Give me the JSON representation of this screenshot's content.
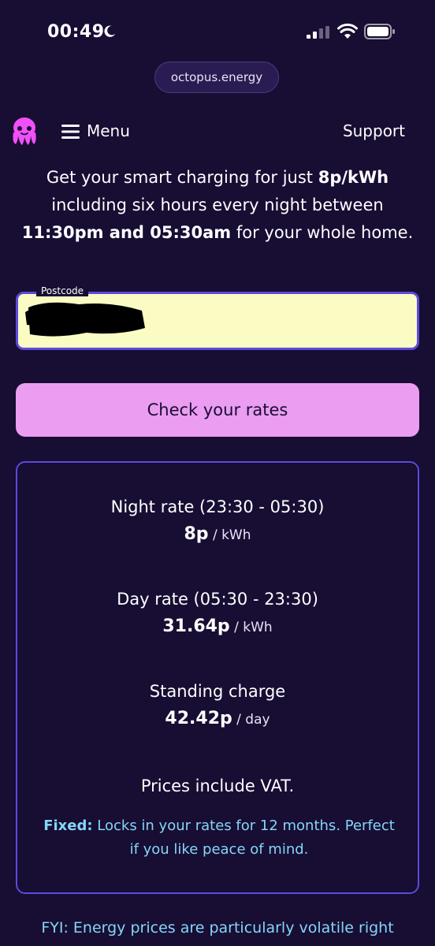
{
  "status_bar": {
    "time": "00:49",
    "icons": [
      "moon-icon",
      "signal-icon",
      "wifi-icon",
      "battery-icon"
    ]
  },
  "browser": {
    "url": "octopus.energy"
  },
  "nav": {
    "logo_icon": "octopus-logo-icon",
    "menu_label": "Menu",
    "support_label": "Support"
  },
  "intro": {
    "part1": "Get your smart charging for just ",
    "price": "8p/kWh",
    "part2": " including six hours every night between ",
    "times": "11:30pm and 05:30am",
    "part3": " for your whole home."
  },
  "postcode": {
    "label": "Postcode",
    "value": ""
  },
  "check_button": {
    "label": "Check your rates"
  },
  "rates": {
    "night": {
      "title": "Night rate (23:30 - 05:30)",
      "value": "8p",
      "unit": " / kWh"
    },
    "day": {
      "title": "Day rate (05:30 - 23:30)",
      "value": "31.64p",
      "unit": " / kWh"
    },
    "standing": {
      "title": "Standing charge",
      "value": "42.42p",
      "unit": " / day"
    },
    "vat_note": "Prices include VAT.",
    "fixed_label": "Fixed:",
    "fixed_text": " Locks in your rates for 12 months. Perfect if you like peace of mind."
  },
  "footer": {
    "fyi": "FYI: Energy prices are particularly volatile right"
  },
  "colors": {
    "background": "#180d33",
    "accent_pink": "#eb9df1",
    "border_purple": "#5b4bdb",
    "info_blue": "#84d6f7",
    "field_yellow": "#fafcc3"
  }
}
